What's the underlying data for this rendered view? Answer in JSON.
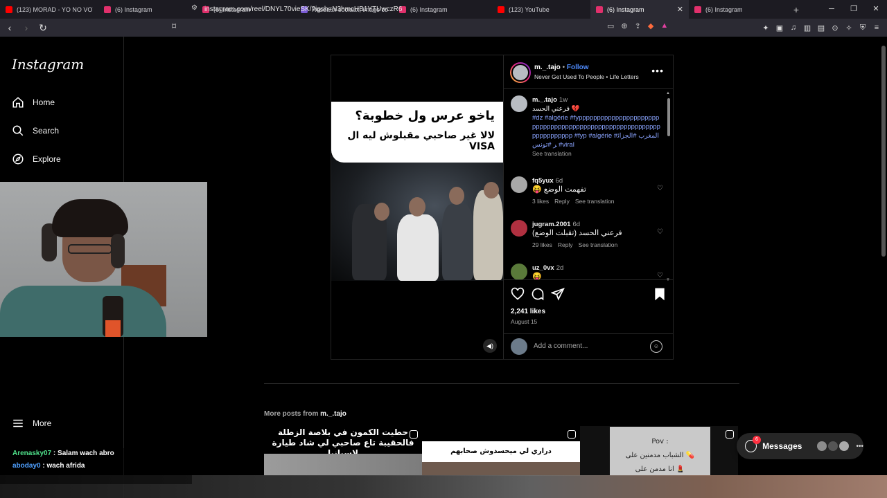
{
  "browser": {
    "tabs": [
      {
        "label": "(123) MORAD - YO NO VOY [V",
        "fav": "#ff0000",
        "active": false
      },
      {
        "label": "(6) Instagram",
        "fav": "#e1306c",
        "active": false
      },
      {
        "label": "(6) Instagram",
        "fav": "#e1306c",
        "active": false
      },
      {
        "label": "Réseaux sociaux, image corpor",
        "fav": "#7b5cd6",
        "active": false
      },
      {
        "label": "(6) Instagram",
        "fav": "#e1306c",
        "active": false
      },
      {
        "label": "(123) YouTube",
        "fav": "#ff0000",
        "active": false
      },
      {
        "label": "(6) Instagram",
        "fav": "#e1306c",
        "active": true
      },
      {
        "label": "(6) Instagram",
        "fav": "#e1306c",
        "active": false
      }
    ],
    "url": "instagram.com/reel/DNYL70vieSK/?igsh=N3hmcHB1YTUwczR6"
  },
  "sidebar": {
    "logo": "Instagram",
    "items": [
      {
        "label": "Home"
      },
      {
        "label": "Search"
      },
      {
        "label": "Explore"
      }
    ],
    "more": "More"
  },
  "post": {
    "caption_line1": "ياخو عرس ول خطوبة؟",
    "caption_line2": "لالا غير صاحبي مقبلوش ليه ال VISA",
    "author": "m._.tajo",
    "dot": "•",
    "follow": "Follow",
    "music": "Never Get Used To People • Life Letters",
    "comments": [
      {
        "user": "m._.tajo",
        "time": "1w",
        "text": "فرعني الحسد 💔",
        "tags": "#dz #algérie #fypppppppppppppppppppppppppppppppppppppppppppppppppppppppppppppppppppp #fyp #algérie #المغرب #الجزائر #تونس #viral",
        "translate": "See translation"
      },
      {
        "user": "fq5yux",
        "time": "6d",
        "text": "😝 تفهمت الوضع",
        "likes": "3 likes",
        "reply": "Reply",
        "translate": "See translation"
      },
      {
        "user": "jugram.2001",
        "time": "6d",
        "text": "فرعني الحسد (تقبلت الوضع)",
        "likes": "29 likes",
        "reply": "Reply",
        "translate": "See translation"
      },
      {
        "user": "uz_0vx",
        "time": "2d",
        "text": "😝"
      }
    ],
    "likes": "2,241 likes",
    "date": "August 15",
    "add_comment_placeholder": "Add a comment..."
  },
  "more_posts": {
    "prefix": "More posts from",
    "user": "m._.tajo",
    "thumbs": [
      {
        "text": "حطيت الكمون في بلاصة الزطلة فالحقيبة تاع صاحبي لي شاد طيارة لإسبانيا"
      },
      {
        "text": "دراري لي ميحسدوش صحابهم"
      },
      {
        "text_l1": "Pov :",
        "text_l2": "الشباب مدمنين على 💊",
        "text_l3": "انا مدمن على 💄"
      }
    ]
  },
  "messages": {
    "label": "Messages",
    "badge": "6"
  },
  "stream_chat": [
    {
      "user": "Arenasky07",
      "msg": " : Salam wach abro"
    },
    {
      "user": "aboday0",
      "msg": " : wach afrida"
    }
  ]
}
